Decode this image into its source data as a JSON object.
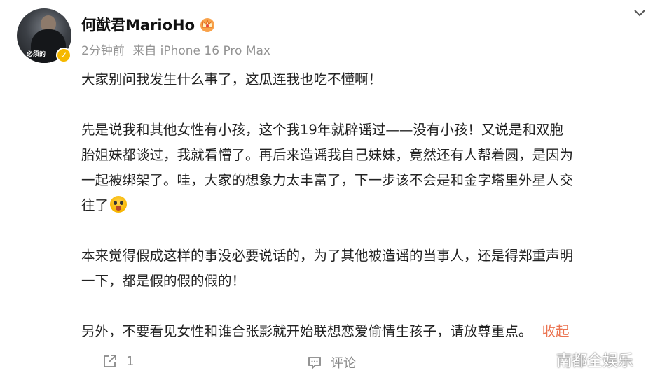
{
  "author": {
    "name": "何猷君MarioHo",
    "avatar_caption": "必须的"
  },
  "meta": {
    "time": "2分钟前",
    "source": "来自 iPhone 16 Pro Max"
  },
  "post": {
    "paragraphs": [
      {
        "lines": [
          "大家别问我发生什么事了，这瓜连我也吃不懂啊！"
        ]
      },
      {
        "lines": [
          "先是说我和其他女性有小孩，这个我19年就辟谣过——没有小孩！又说是和双胞",
          "胎姐妹都谈过，我就看懵了。再后来造谣我自己妹妹，竟然还有人帮着圆，是因为",
          "一起被绑架了。哇，大家的想象力太丰富了，下一步该不会是和金字塔里外星人交",
          "往了"
        ]
      },
      {
        "lines": [
          "本来觉得假成这样的事没必要说话的，为了其他被造谣的当事人，还是得郑重声明",
          "一下，都是假的假的假的！"
        ]
      },
      {
        "lines": [
          "另外，不要看见女性和谁合张影就开始联想恋爱偷情生孩子，请放尊重点。"
        ]
      }
    ],
    "collapse_label": "收起"
  },
  "actions": {
    "repost_count": "1",
    "comment_label": "评论"
  },
  "watermark": {
    "text": "南都全娱乐"
  },
  "colors": {
    "accent": "#eb7350",
    "meta_text": "#939393",
    "verified": "#f5b800"
  }
}
